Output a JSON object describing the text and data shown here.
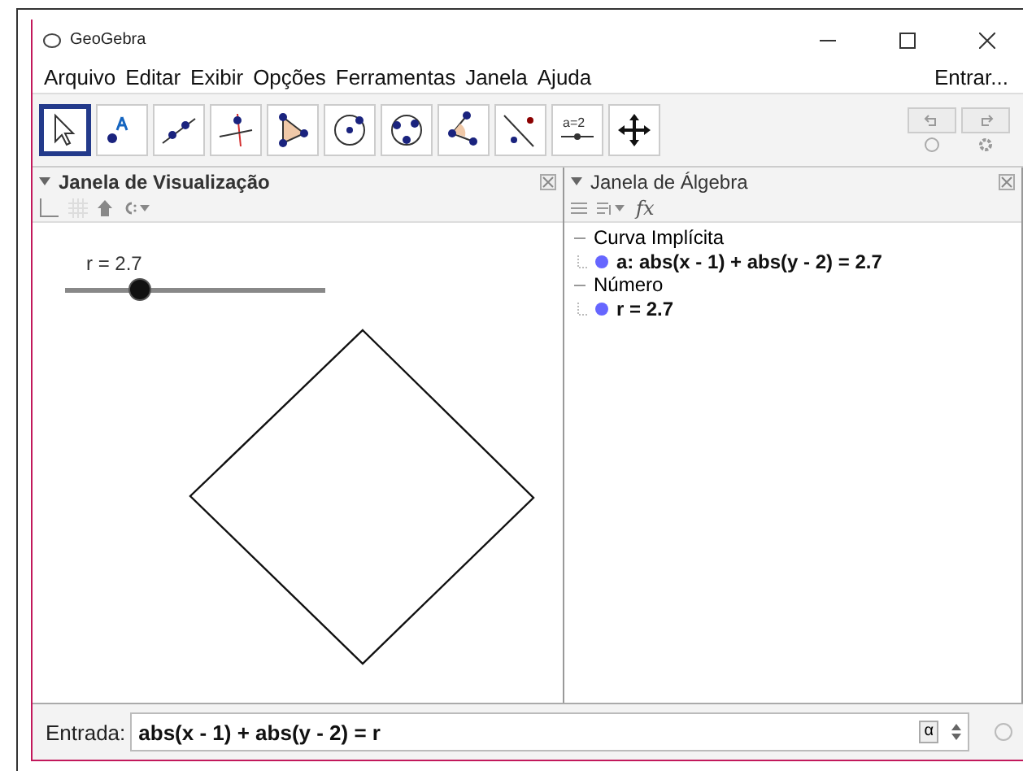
{
  "window": {
    "title": "GeoGebra",
    "sign_in": "Entrar..."
  },
  "menu": [
    "Arquivo",
    "Editar",
    "Exibir",
    "Opções",
    "Ferramentas",
    "Janela",
    "Ajuda"
  ],
  "tools": [
    {
      "selected": true
    },
    {
      "selected": false
    },
    {
      "selected": false
    },
    {
      "selected": false
    },
    {
      "selected": false
    },
    {
      "selected": false
    },
    {
      "selected": false
    },
    {
      "selected": false
    },
    {
      "selected": false
    },
    {
      "selected": false,
      "label": "a=2"
    },
    {
      "selected": false
    }
  ],
  "graphics": {
    "title": "Janela de Visualização",
    "expanded": true,
    "slider": {
      "label": "r = 2.7",
      "level": 0.29
    }
  },
  "algebra": {
    "title": "Janela de Álgebra",
    "expanded": true,
    "toolbar_label": "fx",
    "groups": [
      {
        "label": "Curva Implícita",
        "expanded": true,
        "children": [
          {
            "text": "a: abs(x - 1) + abs(y - 2) = 2.7",
            "color": "#6666ff"
          }
        ]
      },
      {
        "label": "Número",
        "expanded": true,
        "children": [
          {
            "text": "r = 2.7",
            "color": "#6666ff"
          }
        ]
      }
    ]
  },
  "input_bar": {
    "label": "Entrada:",
    "value": "abs(x - 1) + abs(y - 2) = r",
    "symbol_button": "α"
  }
}
